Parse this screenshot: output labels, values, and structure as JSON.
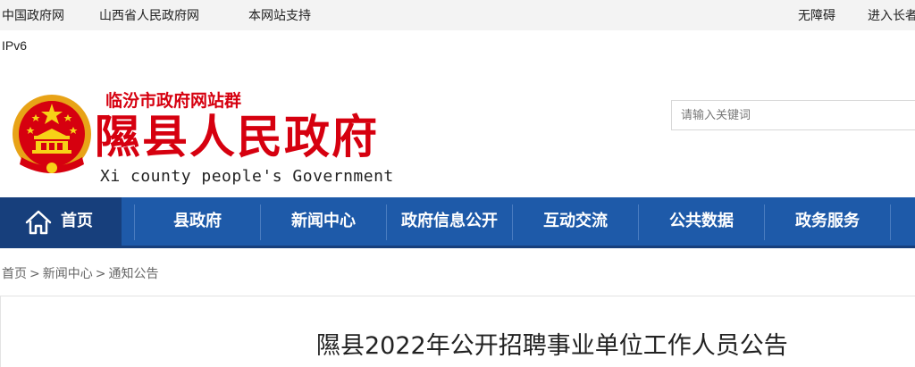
{
  "topbar": {
    "links": [
      "中国政府网",
      "山西省人民政府网",
      "本网站支持"
    ],
    "accessibility": "无障碍",
    "elder_mode": "进入长者"
  },
  "ipv6": "IPv6",
  "header": {
    "site_group": "临汾市政府网站群",
    "title": "隰县人民政府",
    "subtitle": "Xi county people's Government",
    "search_placeholder": "请输入关键词"
  },
  "nav": {
    "items": [
      "首页",
      "县政府",
      "新闻中心",
      "政府信息公开",
      "互动交流",
      "公共数据",
      "政务服务"
    ]
  },
  "breadcrumb": [
    "首页",
    "新闻中心",
    "通知公告"
  ],
  "article": {
    "title": "隰县2022年公开招聘事业单位工作人员公告"
  },
  "colors": {
    "brand_red": "#d6000f",
    "nav_blue": "#1e5aa9",
    "nav_active": "#173f7c"
  }
}
